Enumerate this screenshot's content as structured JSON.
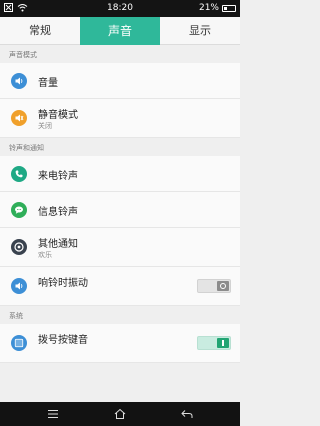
{
  "status_bar": {
    "time": "18:20",
    "battery": "21%"
  },
  "tabs": [
    {
      "label": "常规",
      "active": false
    },
    {
      "label": "声音",
      "active": true
    },
    {
      "label": "显示",
      "active": false
    }
  ],
  "sections": {
    "sound_mode": "声音模式",
    "ring_notify": "铃声和通知",
    "system": "系统"
  },
  "items": {
    "volume": {
      "title": "音量",
      "icon": "volume-icon"
    },
    "silent": {
      "title": "静音模式",
      "subtitle": "关闭",
      "icon": "bell-icon"
    },
    "ringtone": {
      "title": "来电铃声",
      "icon": "phone-icon"
    },
    "message": {
      "title": "信息铃声",
      "icon": "message-icon"
    },
    "other": {
      "title": "其他通知",
      "subtitle": "欢乐",
      "icon": "notification-icon"
    },
    "vibrate": {
      "title": "响铃时振动",
      "toggle": false,
      "icon": "vibrate-icon"
    },
    "dialpad": {
      "title": "拨号按键音",
      "toggle": true,
      "icon": "dialpad-icon"
    }
  },
  "colors": {
    "accent": "#2fb89a",
    "blue": "#3d8fd6",
    "orange": "#f0a02b",
    "teal": "#1fa985",
    "green": "#2fae59",
    "dark": "#39424e"
  }
}
